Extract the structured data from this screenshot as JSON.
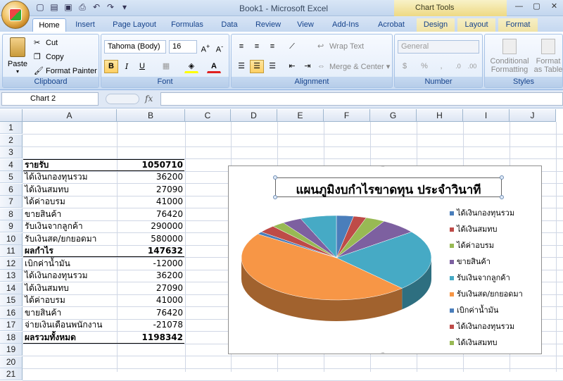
{
  "window": {
    "title": "Book1 - Microsoft Excel",
    "context_tab_group": "Chart Tools"
  },
  "tabs": [
    {
      "label": "Home",
      "active": true
    },
    {
      "label": "Insert"
    },
    {
      "label": "Page Layout"
    },
    {
      "label": "Formulas"
    },
    {
      "label": "Data"
    },
    {
      "label": "Review"
    },
    {
      "label": "View"
    },
    {
      "label": "Add-Ins"
    },
    {
      "label": "Acrobat"
    },
    {
      "label": "Design",
      "context": true
    },
    {
      "label": "Layout",
      "context": true
    },
    {
      "label": "Format",
      "context": true
    }
  ],
  "ribbon": {
    "clipboard": {
      "label": "Clipboard",
      "paste": "Paste",
      "cut": "Cut",
      "copy": "Copy",
      "format_painter": "Format Painter"
    },
    "font": {
      "label": "Font",
      "font_name": "Tahoma (Body)",
      "font_size": "16",
      "bold": "B",
      "italic": "I",
      "underline": "U"
    },
    "alignment": {
      "label": "Alignment",
      "wrap_text": "Wrap Text",
      "merge_center": "Merge & Center"
    },
    "number": {
      "label": "Number",
      "format": "General",
      "percent": "%",
      "comma": ","
    },
    "styles": {
      "label": "Styles",
      "conditional_formatting": "Conditional Formatting",
      "format_as_table": "Format as Table"
    }
  },
  "formula_bar": {
    "name_box": "Chart 2",
    "fx": "fx",
    "formula": ""
  },
  "columns": [
    "A",
    "B",
    "C",
    "D",
    "E",
    "F",
    "G",
    "H",
    "I",
    "J"
  ],
  "rows": [
    "1",
    "2",
    "3",
    "4",
    "5",
    "6",
    "7",
    "8",
    "9",
    "10",
    "11",
    "12",
    "13",
    "14",
    "15",
    "16",
    "17",
    "18",
    "19",
    "20",
    "21"
  ],
  "cells": [
    {
      "row": 4,
      "a": "รายรับ",
      "b": "1050710",
      "bold": true
    },
    {
      "row": 5,
      "a": "ได้เงินกองทุนรวม",
      "b": "36200"
    },
    {
      "row": 6,
      "a": "ได้เงินสมทบ",
      "b": "27090"
    },
    {
      "row": 7,
      "a": "ได้ค่าอบรม",
      "b": "41000"
    },
    {
      "row": 8,
      "a": "ขายสินค้า",
      "b": "76420"
    },
    {
      "row": 9,
      "a": "รับเงินจากลูกค้า",
      "b": "290000"
    },
    {
      "row": 10,
      "a": "รับเงินสด/ยกยอดมา",
      "b": "580000"
    },
    {
      "row": 11,
      "a": "ผลกำไร",
      "b": "147632",
      "bold": true
    },
    {
      "row": 12,
      "a": "เบิกค่าน้ำมัน",
      "b": "-12000"
    },
    {
      "row": 13,
      "a": "ได้เงินกองทุนรวม",
      "b": "36200"
    },
    {
      "row": 14,
      "a": "ได้เงินสมทบ",
      "b": "27090"
    },
    {
      "row": 15,
      "a": "ได้ค่าอบรม",
      "b": "41000"
    },
    {
      "row": 16,
      "a": "ขายสินค้า",
      "b": "76420"
    },
    {
      "row": 17,
      "a": "จ่ายเงินเดือนพนักงาน",
      "b": "-21078"
    },
    {
      "row": 18,
      "a": "ผลรวมทั้งหมด",
      "b": "1198342",
      "bold": true
    }
  ],
  "chart_data": {
    "type": "pie",
    "title": "แผนภูมิงบกำไรขาดทุน ประจำวินาที",
    "categories": [
      "ได้เงินกองทุนรวม",
      "ได้เงินสมทบ",
      "ได้ค่าอบรม",
      "ขายสินค้า",
      "รับเงินจากลูกค้า",
      "รับเงินสด/ยกยอดมา",
      "เบิกค่าน้ำมัน",
      "ได้เงินกองทุนรวม",
      "ได้เงินสมทบ",
      "ได้ค่าอบรม",
      "ขายสินค้า"
    ],
    "values": [
      36200,
      27090,
      41000,
      76420,
      290000,
      580000,
      12000,
      36200,
      27090,
      41000,
      76420
    ],
    "colors": [
      "#4a7ebb",
      "#be4b48",
      "#98b954",
      "#7d60a0",
      "#46aac5",
      "#f79646",
      "#4a7ebb",
      "#be4b48",
      "#98b954",
      "#7d60a0",
      "#46aac5"
    ],
    "legend_visible": [
      "ได้เงินกองทุนรวม",
      "ได้เงินสมทบ",
      "ได้ค่าอบรม",
      "ขายสินค้า",
      "รับเงินจากลูกค้า",
      "รับเงินสด/ยกยอดมา",
      "เบิกค่าน้ำมัน",
      "ได้เงินกองทุนรวม",
      "ได้เงินสมทบ"
    ],
    "style": "3d",
    "legend_position": "right"
  }
}
